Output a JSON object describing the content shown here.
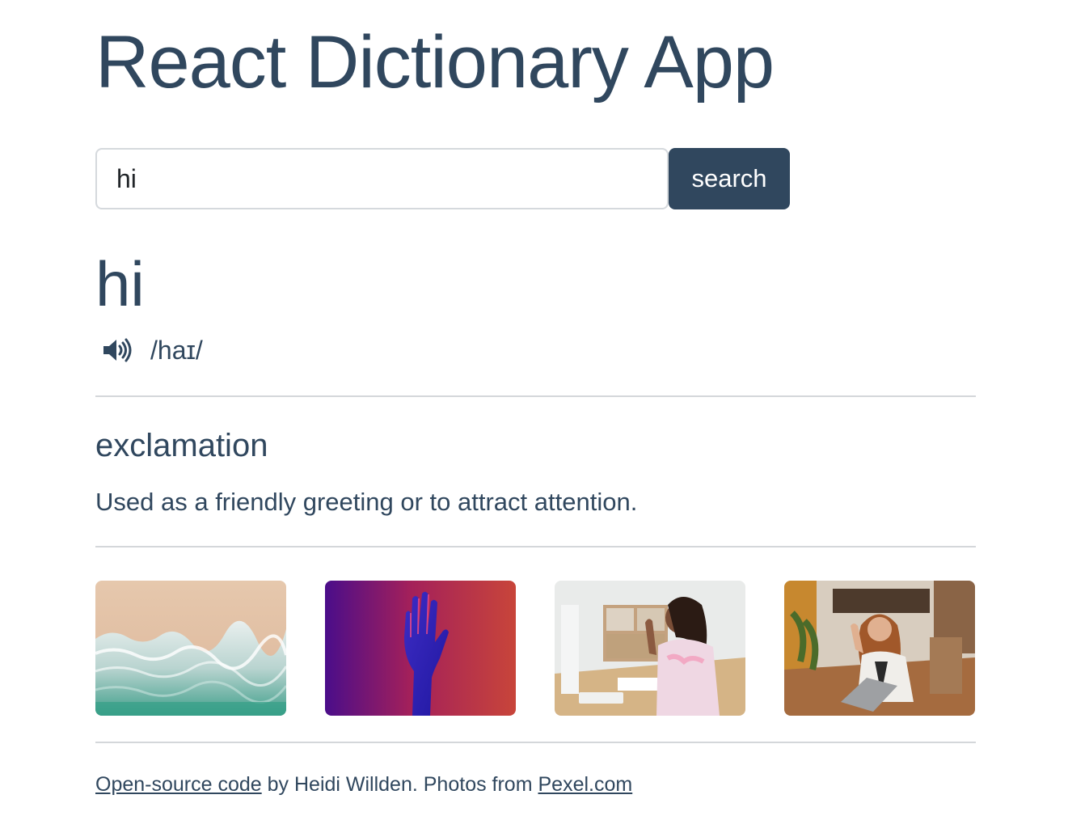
{
  "app": {
    "title": "React Dictionary App"
  },
  "search": {
    "value": "hi",
    "button_label": "search"
  },
  "result": {
    "word": "hi",
    "phonetic": "/haɪ/",
    "audio_icon": "speaker-icon"
  },
  "meaning": {
    "part_of_speech": "exclamation",
    "definition": "Used as a friendly greeting or to attract attention."
  },
  "photos": [
    {
      "subject": "ocean-waves-on-sand"
    },
    {
      "subject": "raised-hand-neon-light"
    },
    {
      "subject": "girl-waving-at-desk"
    },
    {
      "subject": "woman-waving-at-laptop"
    }
  ],
  "footer": {
    "code_link": "Open-source code",
    "by_text": " by Heidi Willden. Photos from ",
    "photos_link": "Pexel.com"
  },
  "colors": {
    "primary": "#30475e",
    "divider": "#d4d7da",
    "input_border": "#d5d9dd"
  }
}
